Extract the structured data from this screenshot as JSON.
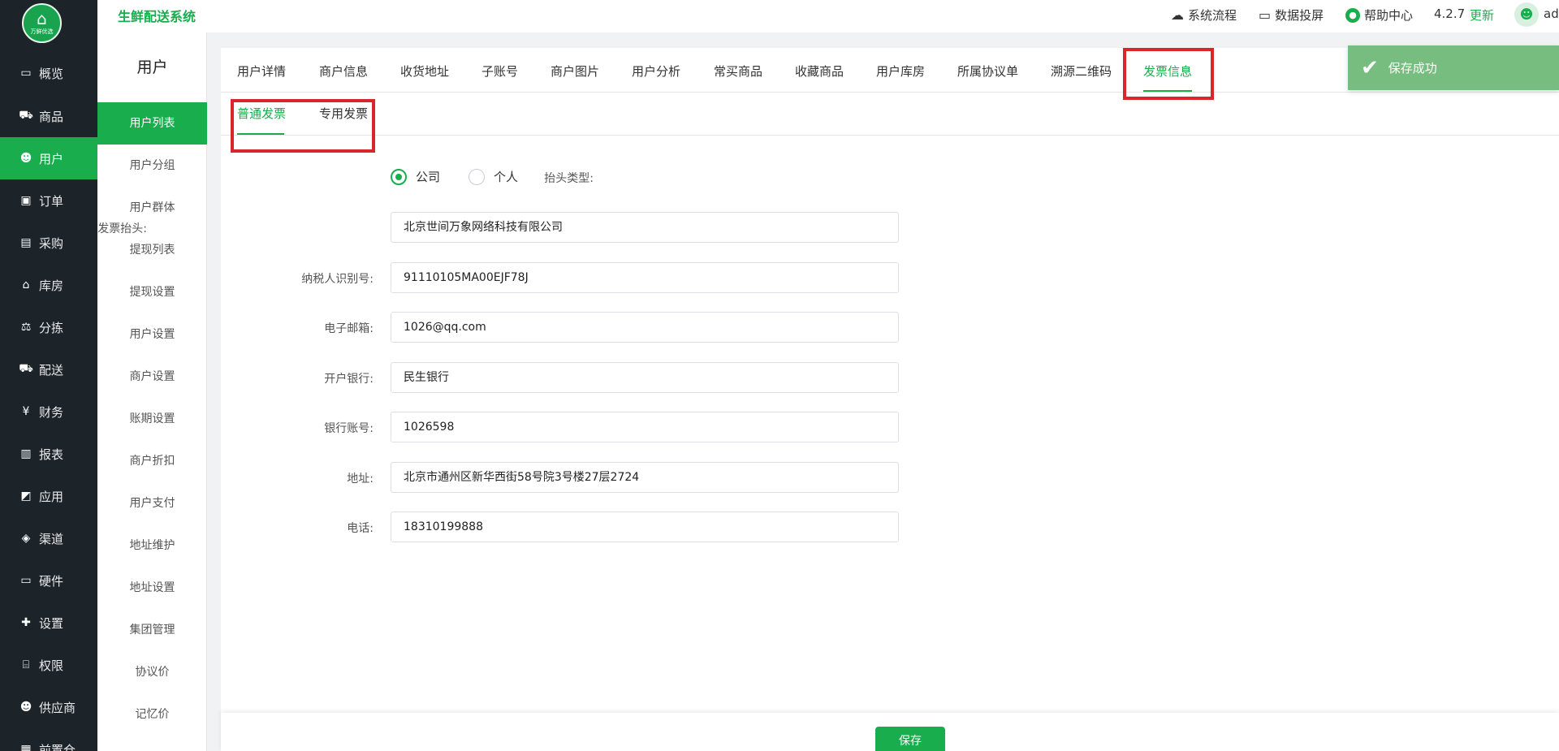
{
  "app": {
    "logo_text": "万鲜优选",
    "title": "生鲜配送系统"
  },
  "topbar": {
    "process_label": "系统流程",
    "screen_label": "数据投屏",
    "help_label": "帮助中心",
    "version": "4.2.7",
    "update_label": "更新",
    "username": "ad"
  },
  "sidebar": {
    "items": [
      {
        "label": "概览",
        "icon": "monitor-icon"
      },
      {
        "label": "商品",
        "icon": "cart-icon"
      },
      {
        "label": "用户",
        "icon": "users-icon"
      },
      {
        "label": "订单",
        "icon": "money-icon"
      },
      {
        "label": "采购",
        "icon": "bus-icon"
      },
      {
        "label": "库房",
        "icon": "home-icon"
      },
      {
        "label": "分拣",
        "icon": "scale-icon"
      },
      {
        "label": "配送",
        "icon": "truck-icon"
      },
      {
        "label": "财务",
        "icon": "yen-icon"
      },
      {
        "label": "报表",
        "icon": "bar-chart-icon"
      },
      {
        "label": "应用",
        "icon": "app-icon"
      },
      {
        "label": "渠道",
        "icon": "cube-icon"
      },
      {
        "label": "硬件",
        "icon": "desktop-icon"
      },
      {
        "label": "设置",
        "icon": "puzzle-icon"
      },
      {
        "label": "权限",
        "icon": "bank-icon"
      },
      {
        "label": "供应商",
        "icon": "users-icon"
      },
      {
        "label": "前置仓",
        "icon": "warehouse-icon"
      }
    ]
  },
  "submenu": {
    "title": "用户",
    "items": [
      "用户列表",
      "用户分组",
      "用户群体",
      "提现列表",
      "提现设置",
      "用户设置",
      "商户设置",
      "账期设置",
      "商户折扣",
      "用户支付",
      "地址维护",
      "地址设置",
      "集团管理",
      "协议价",
      "记忆价"
    ]
  },
  "tabs": [
    "用户详情",
    "商户信息",
    "收货地址",
    "子账号",
    "商户图片",
    "用户分析",
    "常买商品",
    "收藏商品",
    "用户库房",
    "所属协议单",
    "溯源二维码",
    "发票信息"
  ],
  "subtabs": [
    "普通发票",
    "专用发票"
  ],
  "form": {
    "title_type_label": "抬头类型:",
    "title_type_options": [
      "公司",
      "个人"
    ],
    "title_type_selected": "公司",
    "fields": [
      {
        "label": "发票抬头:",
        "value": "北京世间万象网络科技有限公司"
      },
      {
        "label": "纳税人识别号:",
        "value": "91110105MA00EJF78J"
      },
      {
        "label": "电子邮箱:",
        "value": "1026@qq.com"
      },
      {
        "label": "开户银行:",
        "value": "民生银行"
      },
      {
        "label": "银行账号:",
        "value": "1026598"
      },
      {
        "label": "地址:",
        "value": "北京市通州区新华西街58号院3号楼27层2724"
      },
      {
        "label": "电话:",
        "value": "18310199888"
      }
    ]
  },
  "save_label": "保存",
  "toast": {
    "message": "保存成功",
    "icon": "check-icon"
  },
  "colors": {
    "accent": "#1aad4e",
    "sidebar": "#1c2329",
    "highlight_box": "#d9262d",
    "toast": "#77bd7f"
  }
}
